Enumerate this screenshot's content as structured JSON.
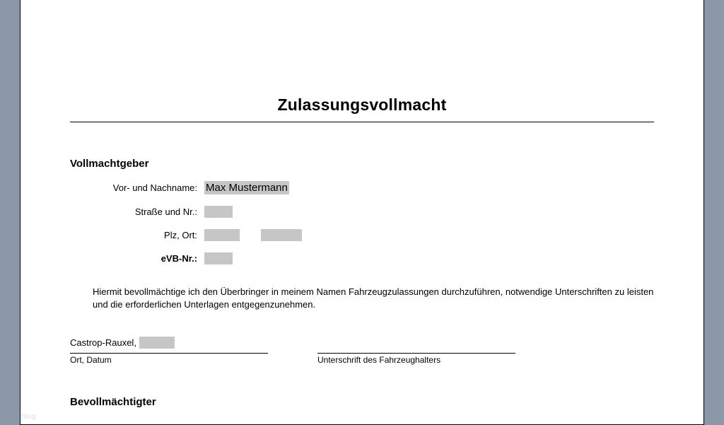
{
  "title": "Zulassungsvollmacht",
  "section1_heading": "Vollmachtgeber",
  "fields": {
    "name_label": "Vor- und Nachname:",
    "name_value": "Max Mustermann",
    "street_label": "Straße und Nr.:",
    "city_label": "Plz, Ort:",
    "evb_label": "eVB-Nr.:"
  },
  "paragraph": "Hiermit bevollmächtige ich den Überbringer in meinem Namen Fahrzeugzulassungen durchzuführen, notwendige Unterschriften zu leisten und die erforderlichen Unterlagen entgegenzunehmen.",
  "signature": {
    "city_prefix": "Castrop-Rauxel,",
    "left_label": "Ort, Datum",
    "right_label": "Unterschrift des Fahrzeughalters"
  },
  "section2_heading": "Bevollmächtigter",
  "watermark": "blog"
}
